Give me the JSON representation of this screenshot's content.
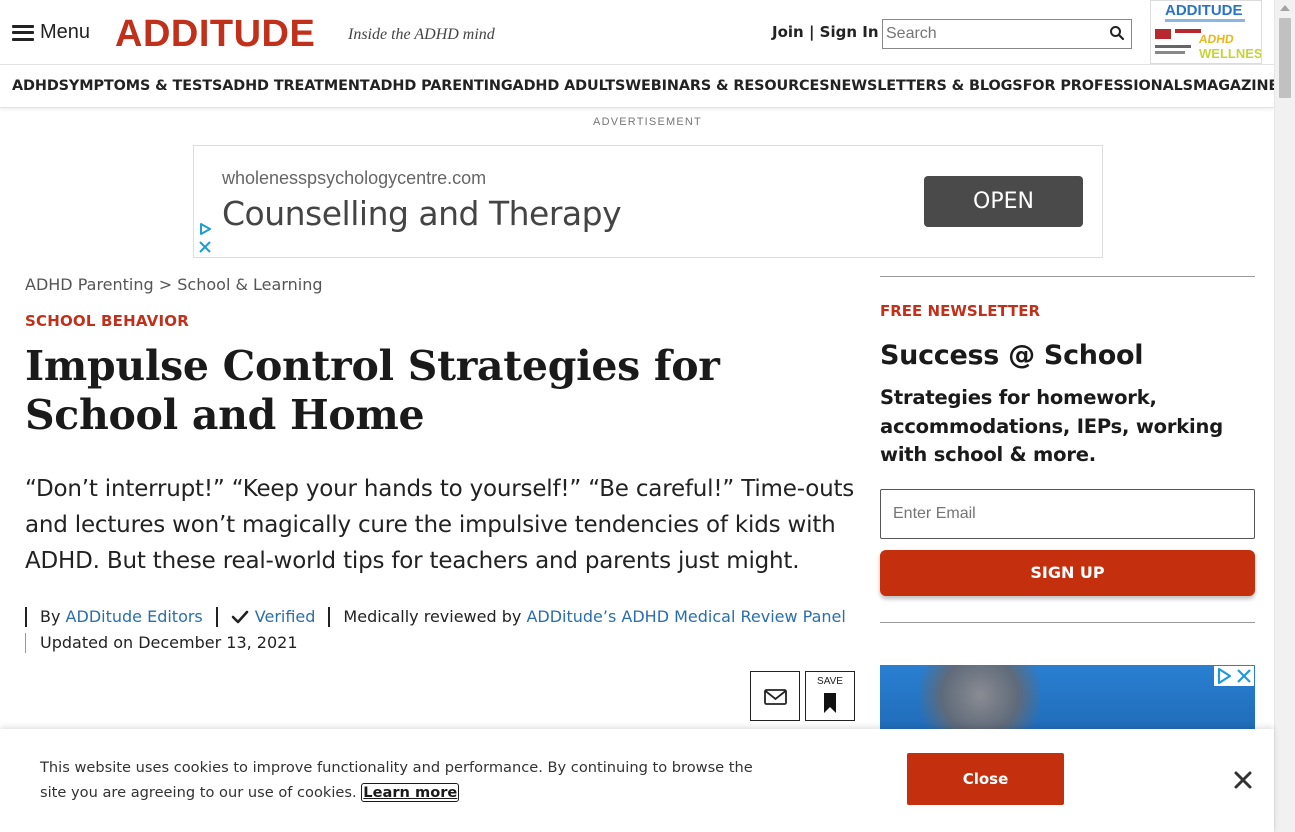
{
  "header": {
    "menu_label": "Menu",
    "logo": "ADDITUDE",
    "tagline": "Inside the ADHD mind",
    "join_label": "Join",
    "sign_in_label": "Sign In",
    "search_placeholder": "Search",
    "magazine": {
      "title": "ADDITUDE",
      "badge_line1": "ADHD",
      "badge_line2": "WELLNESS"
    }
  },
  "nav": {
    "items": [
      "ADHD",
      "SYMPTOMS & TESTS",
      "ADHD TREATMENT",
      "ADHD PARENTING",
      "ADHD ADULTS",
      "WEBINARS & RESOURCES",
      "NEWSLETTERS & BLOGS",
      "FOR PROFESSIONALS",
      "MAGAZINE"
    ]
  },
  "ad": {
    "label": "ADVERTISEMENT",
    "domain": "wholenesspsychologycentre.com",
    "headline": "Counselling and Therapy",
    "cta": "OPEN"
  },
  "article": {
    "breadcrumb": [
      "ADHD Parenting",
      "School & Learning"
    ],
    "breadcrumb_sep": ">",
    "category": "SCHOOL BEHAVIOR",
    "title": "Impulse Control Strategies for School and Home",
    "dek": "“Don’t interrupt!” “Keep your hands to yourself!” “Be careful!” Time-outs and lectures won’t magically cure the impulsive tendencies of kids with ADHD. But these real-world tips for teachers and parents just might.",
    "byline_prefix": "By",
    "author": "ADDitude Editors",
    "verified": "Verified",
    "reviewed_prefix": "Medically reviewed by",
    "reviewer": "ADDitude’s ADHD Medical Review Panel",
    "updated": "Updated on December 13, 2021",
    "save_label": "SAVE"
  },
  "sidebar": {
    "label": "FREE NEWSLETTER",
    "title": "Success @ School",
    "description": "Strategies for homework, accommodations, IEPs, working with school & more.",
    "email_placeholder": "Enter Email",
    "signup_label": "SIGN UP"
  },
  "cookie": {
    "text": "This website uses cookies to improve functionality and performance. By continuing to browse the site you are agreeing to our use of cookies.",
    "learn_more": "Learn more",
    "close_label": "Close"
  },
  "colors": {
    "brand_red": "#c0301a",
    "button_red": "#c42f0e",
    "link_blue": "#2a6fab",
    "ad_blue": "#2a7fd1"
  }
}
